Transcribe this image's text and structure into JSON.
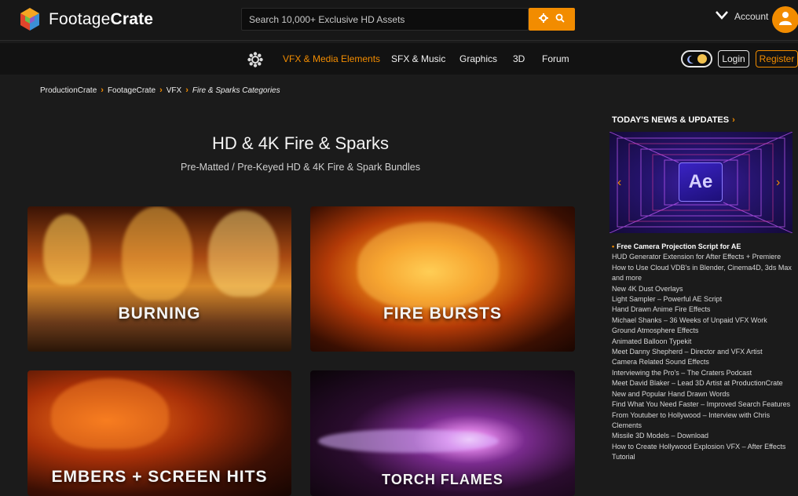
{
  "header": {
    "brand_light": "Footage",
    "brand_bold": "Crate",
    "search_placeholder": "Search 10,000+ Exclusive HD Assets",
    "account_label": "Account"
  },
  "nav": {
    "items": [
      {
        "label": "VFX & Media Elements",
        "active": true
      },
      {
        "label": "SFX & Music",
        "active": false
      },
      {
        "label": "Graphics",
        "active": false
      },
      {
        "label": "3D",
        "active": false
      },
      {
        "label": "Forum",
        "active": false
      }
    ],
    "login_label": "Login",
    "register_label": "Register"
  },
  "breadcrumb": [
    "ProductionCrate",
    "FootageCrate",
    "VFX",
    "Fire & Sparks Categories"
  ],
  "main": {
    "title": "HD & 4K Fire & Sparks",
    "subtitle": "Pre-Matted / Pre-Keyed HD & 4K Fire & Spark Bundles",
    "tiles": [
      {
        "label": "BURNING"
      },
      {
        "label": "FIRE BURSTS"
      },
      {
        "label": "EMBERS + SCREEN HITS"
      },
      {
        "label": "TORCH FLAMES"
      }
    ]
  },
  "sidebar": {
    "heading": "TODAY'S NEWS & UPDATES",
    "banner_text": "Ae",
    "news": [
      "Free Camera Projection Script for AE",
      "HUD Generator Extension for After Effects + Premiere",
      "How to Use Cloud VDB's in Blender, Cinema4D, 3ds Max and more",
      "New 4K Dust Overlays",
      "Light Sampler – Powerful AE Script",
      "Hand Drawn Anime Fire Effects",
      "Michael Shanks – 36 Weeks of Unpaid VFX Work",
      "Ground Atmosphere Effects",
      "Animated Balloon Typekit",
      "Meet Danny Shepherd – Director and VFX Artist",
      "Camera Related Sound Effects",
      "Interviewing the Pro's – The Craters Podcast",
      "Meet David Blaker – Lead 3D Artist at ProductionCrate",
      "New and Popular Hand Drawn Words",
      "Find What You Need Faster – Improved Search Features",
      "From Youtuber to Hollywood – Interview with Chris Clements",
      "Missile 3D Models – Download",
      "How to Create Hollywood Explosion VFX – After Effects Tutorial"
    ]
  },
  "colors": {
    "accent": "#f28c00",
    "background": "#1b1b1b"
  },
  "icons": [
    "logo-cube-icon",
    "settings-gear-icon",
    "search-icon",
    "chevron-down-icon",
    "user-icon",
    "cog-flower-icon",
    "moon-icon",
    "chevron-left-icon",
    "chevron-right-icon"
  ]
}
